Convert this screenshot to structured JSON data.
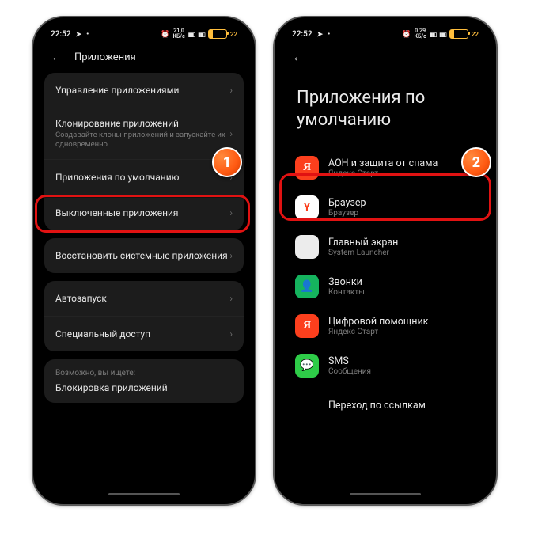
{
  "status": {
    "time": "22:52",
    "net_text1": "21,0\nКБ/с",
    "net_text2": "0.29\nКБ/с",
    "battery": "22"
  },
  "left": {
    "header_title": "Приложения",
    "group1": {
      "manage": "Управление приложениями",
      "clone": "Клонирование приложений",
      "clone_sub": "Создавайте клоны приложений и запускайте их одновременно.",
      "defaults": "Приложения по умолчанию",
      "disabled": "Выключенные приложения"
    },
    "restore": "Восстановить системные приложения",
    "group2": {
      "autostart": "Автозапуск",
      "special": "Специальный доступ"
    },
    "footer": {
      "note": "Возможно, вы ищете:",
      "link": "Блокировка приложений"
    }
  },
  "right": {
    "title": "Приложения по умолчанию",
    "rows": {
      "caller": {
        "title": "АОН и защита от спама",
        "sub": "Яндекс Старт"
      },
      "browser": {
        "title": "Браузер",
        "sub": "Браузер"
      },
      "launcher": {
        "title": "Главный экран",
        "sub": "System Launcher"
      },
      "calls": {
        "title": "Звонки",
        "sub": "Контакты"
      },
      "assist": {
        "title": "Цифровой помощник",
        "sub": "Яндекс Старт"
      },
      "sms": {
        "title": "SMS",
        "sub": "Сообщения"
      }
    },
    "links": "Переход по ссылкам"
  },
  "badges": {
    "one": "1",
    "two": "2"
  }
}
